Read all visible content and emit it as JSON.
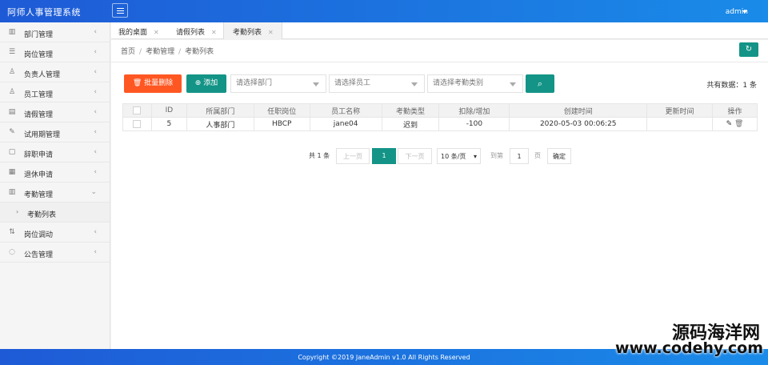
{
  "app": {
    "title": "阿师人事管理系统",
    "user": "admin"
  },
  "sidebar": {
    "items": [
      {
        "label": "部门管理",
        "icon": "▥"
      },
      {
        "label": "岗位管理",
        "icon": "☰"
      },
      {
        "label": "负责人管理",
        "icon": "♙"
      },
      {
        "label": "员工管理",
        "icon": "♙"
      },
      {
        "label": "请假管理",
        "icon": "▤"
      },
      {
        "label": "试用期管理",
        "icon": "✎"
      },
      {
        "label": "辞职申请",
        "icon": "▢"
      },
      {
        "label": "退休申请",
        "icon": "▦"
      },
      {
        "label": "考勤管理",
        "icon": "▥"
      }
    ],
    "sub_item": "考勤列表",
    "items_after": [
      {
        "label": "岗位调动",
        "icon": "⇅"
      },
      {
        "label": "公告管理",
        "icon": "◌"
      }
    ]
  },
  "tabs": [
    "我的桌面",
    "请假列表",
    "考勤列表"
  ],
  "breadcrumb": [
    "首页",
    "考勤管理",
    "考勤列表"
  ],
  "toolbar": {
    "delete_label": "批量删除",
    "add_label": "添加",
    "dept_placeholder": "请选择部门",
    "staff_placeholder": "请选择员工",
    "type_placeholder": "请选择考勤类别",
    "total_label": "共有数据：1 条"
  },
  "table": {
    "headers": [
      "ID",
      "所属部门",
      "任职岗位",
      "员工名称",
      "考勤类型",
      "扣除/增加",
      "创建时间",
      "更新时间",
      "操作"
    ],
    "rows": [
      [
        "5",
        "人事部门",
        "HBCP",
        "jane04",
        "迟到",
        "-100",
        "2020-05-03 00:06:25",
        ""
      ]
    ]
  },
  "pager": {
    "total": "共 1 条",
    "prev": "上一页",
    "current": "1",
    "next": "下一页",
    "size": "10 条/页",
    "goto": "到第",
    "goto_value": "1",
    "page_unit": "页",
    "confirm": "确定"
  },
  "footer": "Copyright ©2019 JaneAdmin v1.0 All Rights Reserved",
  "watermark": {
    "line1": "源码海洋网",
    "line2": "www.codehy.com"
  },
  "colors": {
    "primary": "#139486",
    "danger": "#ff5722",
    "header": "#1e5ad6"
  }
}
